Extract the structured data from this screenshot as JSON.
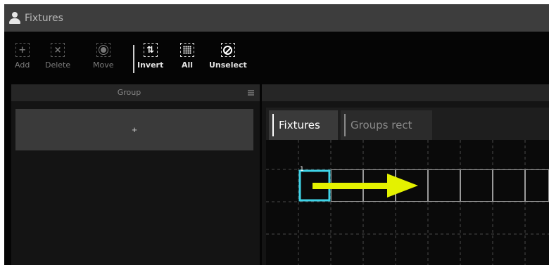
{
  "window": {
    "title": "Fixtures",
    "title_icon": "user-icon"
  },
  "toolbar": {
    "add": {
      "label": "Add",
      "icon": "plus-icon"
    },
    "delete": {
      "label": "Delete",
      "icon": "x-icon"
    },
    "move": {
      "label": "Move",
      "icon": "gear-icon"
    },
    "invert": {
      "label": "Invert",
      "icon": "invert-arrows-icon"
    },
    "all": {
      "label": "All",
      "icon": "select-all-grid-icon"
    },
    "unselect": {
      "label": "Unselect",
      "icon": "no-entry-icon"
    }
  },
  "group_panel": {
    "header": "Group",
    "add_button": "+"
  },
  "view": {
    "tabs": [
      {
        "label": "Fixtures",
        "active": true
      },
      {
        "label": "Groups rect",
        "active": false
      }
    ],
    "selected_fixture_number": "1",
    "colors": {
      "selection": "#3fd4e8",
      "arrow": "#e4f200"
    }
  }
}
